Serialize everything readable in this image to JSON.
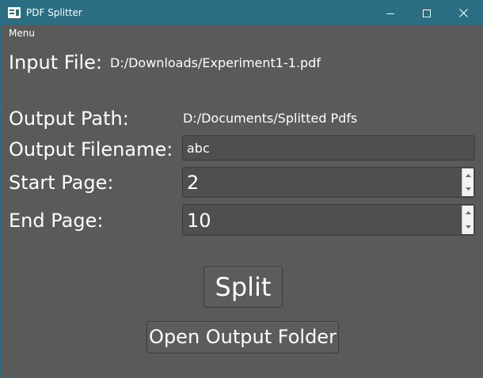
{
  "window": {
    "title": "PDF Splitter",
    "titlebar_color": "#2b6d83",
    "background_color": "#5a5a5a"
  },
  "menu": {
    "items": [
      "Menu"
    ]
  },
  "input_file": {
    "label": "Input File:",
    "value": "D:/Downloads/Experiment1-1.pdf"
  },
  "output_path": {
    "label": "Output Path:",
    "value": "D:/Documents/Splitted Pdfs"
  },
  "output_filename": {
    "label": "Output Filename:",
    "value": "abc"
  },
  "start_page": {
    "label": "Start Page:",
    "value": "2"
  },
  "end_page": {
    "label": "End Page:",
    "value": "10"
  },
  "buttons": {
    "split": "Split",
    "open_output": "Open Output Folder"
  }
}
